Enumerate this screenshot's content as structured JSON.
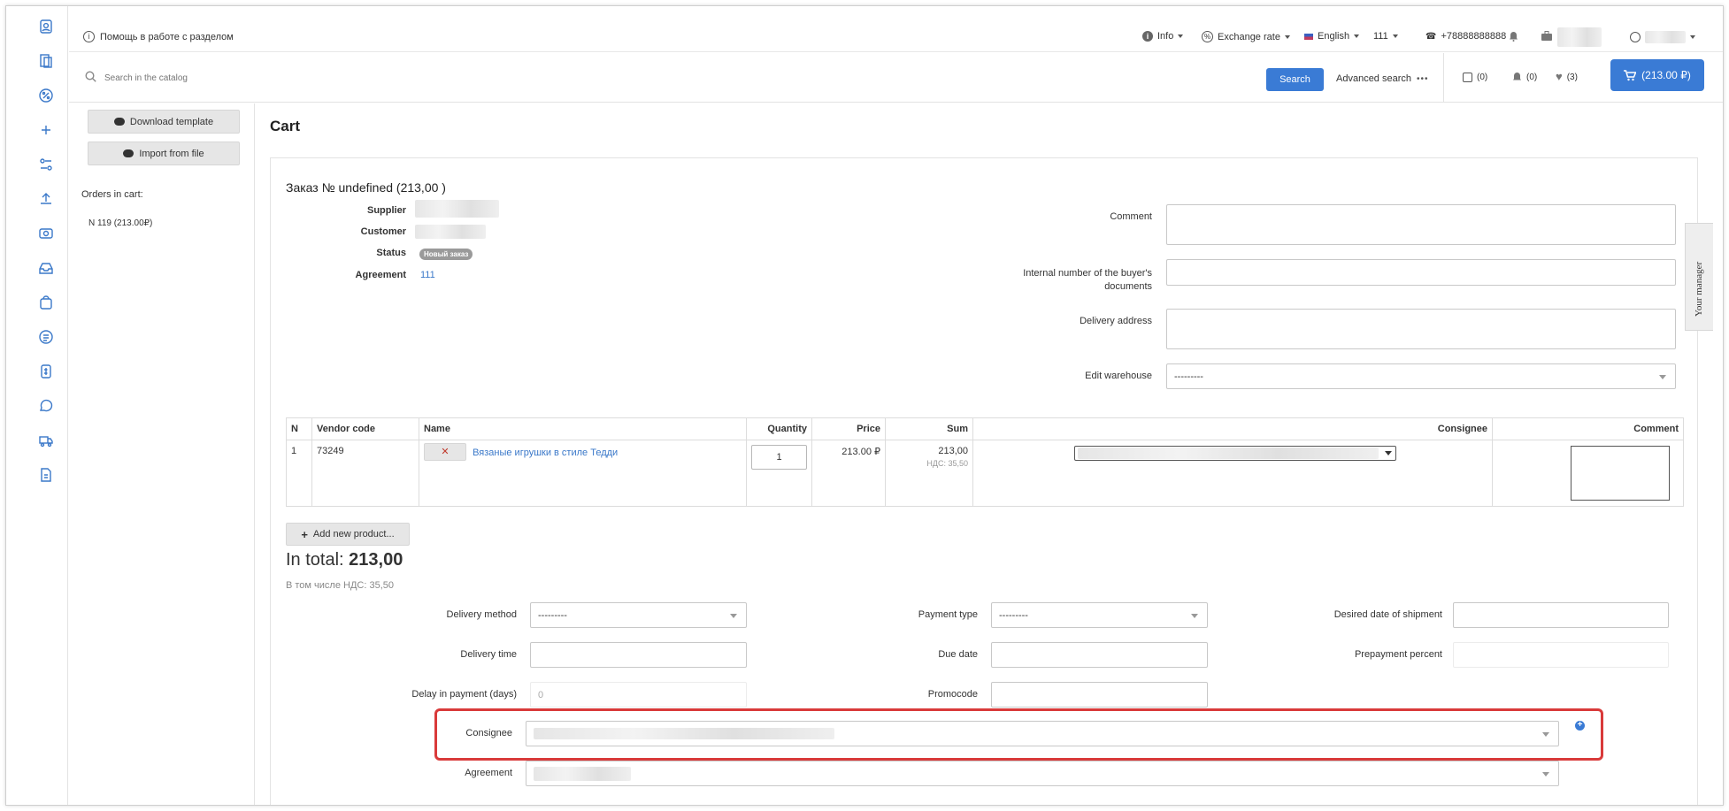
{
  "topbar": {
    "help_label": "Помощь в работе с разделом",
    "info_label": "Info",
    "exchange_label": "Exchange rate",
    "language_label": "English",
    "agreement_label": "111",
    "phone": "+78888888888"
  },
  "search": {
    "placeholder": "Search in the catalog",
    "button_label": "Search",
    "advanced_label": "Advanced search",
    "compare_count": "(0)",
    "notifications_count": "(0)",
    "favorites_count": "(3)",
    "cart_total": "(213.00 ₽)"
  },
  "sidebar": {
    "download_template": "Download template",
    "import_from_file": "Import from file",
    "orders_in_cart_label": "Orders in cart:",
    "order_item": "N 119 (213.00₽)"
  },
  "page": {
    "title": "Cart"
  },
  "order": {
    "heading": "Заказ № undefined (213,00  )",
    "supplier_label": "Supplier",
    "customer_label": "Customer",
    "status_label": "Status",
    "status_value": "Новый заказ",
    "agreement_label": "Agreement",
    "agreement_value": "111",
    "comment_label": "Comment",
    "internal_number_label": "Internal number of the buyer's documents",
    "delivery_address_label": "Delivery address",
    "edit_warehouse_label": "Edit warehouse",
    "edit_warehouse_value": "---------"
  },
  "table": {
    "headers": [
      "N",
      "Vendor code",
      "Name",
      "Quantity",
      "Price",
      "Sum",
      "Consignee",
      "Comment"
    ],
    "row": {
      "n": "1",
      "vendor_code": "73249",
      "name": "Вязаные игрушки в стиле Тедди",
      "quantity": "1",
      "price": "213.00 ₽",
      "sum": "213,00",
      "vat": "НДС: 35,50"
    }
  },
  "totals": {
    "add_product": "Add new product...",
    "in_total_label": "In total:",
    "in_total_value": "213,00",
    "vat_note": "В том числе НДС: 35,50"
  },
  "form": {
    "delivery_method_label": "Delivery method",
    "delivery_method_value": "---------",
    "payment_type_label": "Payment type",
    "payment_type_value": "---------",
    "desired_date_label": "Desired date of shipment",
    "delivery_time_label": "Delivery time",
    "due_date_label": "Due date",
    "prepayment_label": "Prepayment percent",
    "delay_label": "Delay in payment (days)",
    "delay_placeholder": "0",
    "promocode_label": "Promocode",
    "consignee_label": "Consignee",
    "agreement_label": "Agreement"
  },
  "side_tab": {
    "label": "Your manager"
  },
  "colors": {
    "accent": "#3a7bd5",
    "highlight": "#d93a3a",
    "link": "#3a78c9"
  }
}
